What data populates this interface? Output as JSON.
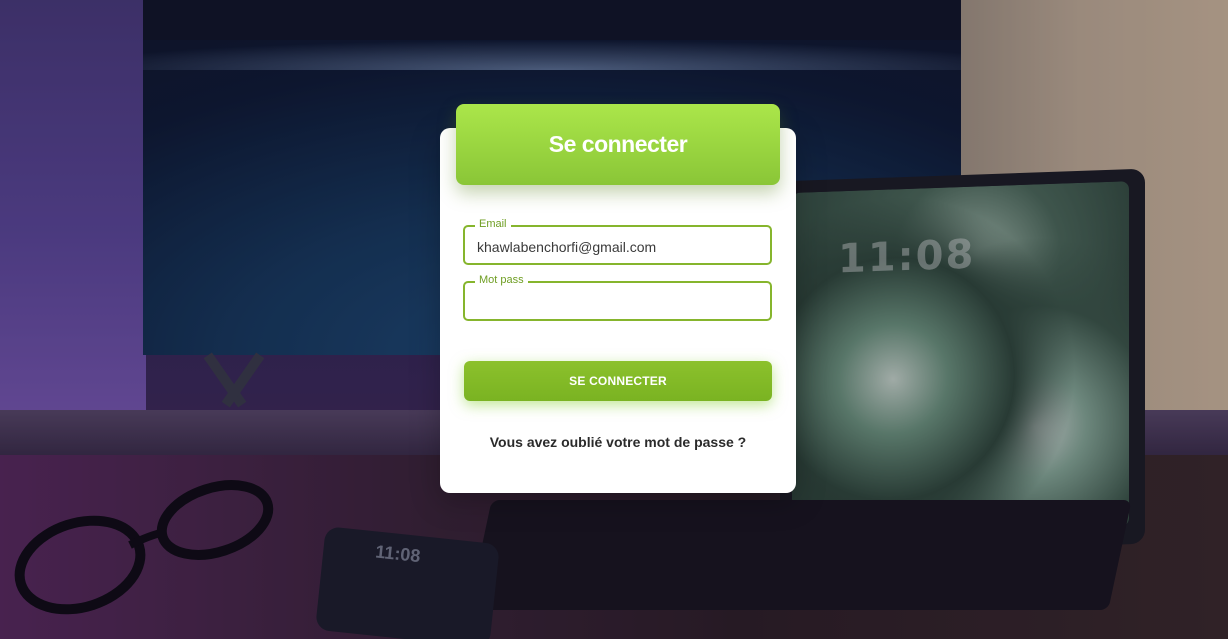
{
  "login": {
    "title": "Se connecter",
    "email": {
      "label": "Email",
      "value": "khawlabenchorfi@gmail.com"
    },
    "password": {
      "label": "Mot pass",
      "value": ""
    },
    "submit_label": "SE CONNECTER",
    "forgot_link": "Vous avez oublié votre mot de passe ?"
  },
  "background": {
    "tablet_time": "11:08",
    "phone_time": "11:08"
  },
  "colors": {
    "accent": "#8cc12c",
    "header_top": "#abe64a",
    "border": "#86b52d"
  }
}
